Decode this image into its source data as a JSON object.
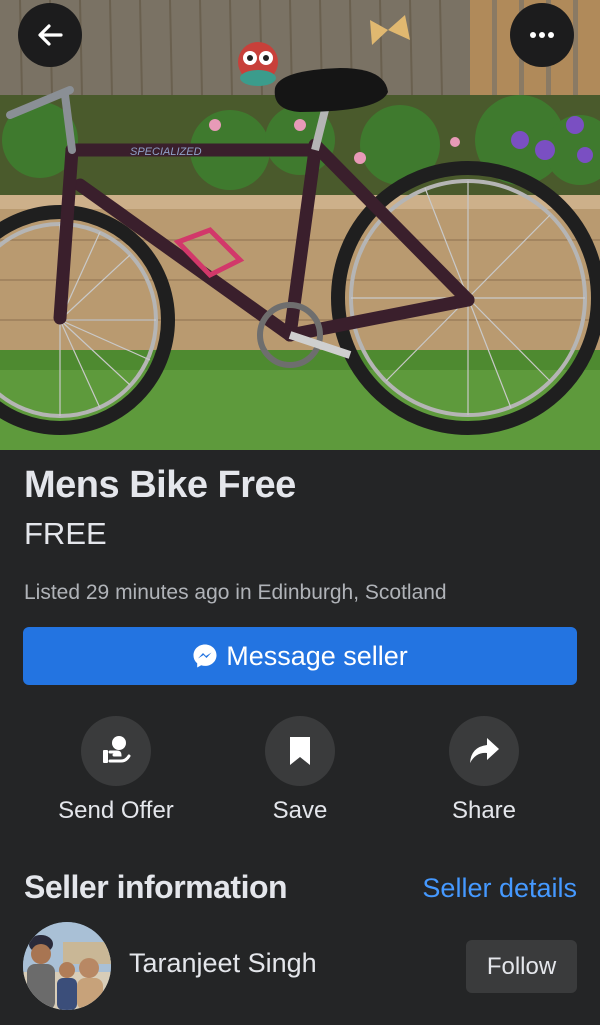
{
  "listing": {
    "title": "Mens Bike Free",
    "price": "FREE",
    "listed_info": "Listed 29 minutes ago in Edinburgh, Scotland"
  },
  "photo": {
    "description_icon": "listing-photo",
    "bike_brand_text": "SPECIALIZED"
  },
  "top_bar": {
    "back_icon": "arrow-left-icon",
    "more_icon": "more-horizontal-icon"
  },
  "primary_action": {
    "label": "Message seller",
    "icon": "messenger-icon"
  },
  "actions": [
    {
      "label": "Send Offer",
      "icon": "hand-offer-icon"
    },
    {
      "label": "Save",
      "icon": "bookmark-icon"
    },
    {
      "label": "Share",
      "icon": "share-arrow-icon"
    }
  ],
  "seller": {
    "heading": "Seller information",
    "details_link": "Seller details",
    "name": "Taranjeet Singh",
    "follow_label": "Follow"
  },
  "colors": {
    "background": "#242526",
    "primary_button": "#2374e1",
    "link": "#4599ff",
    "secondary_button": "#3a3b3c"
  }
}
